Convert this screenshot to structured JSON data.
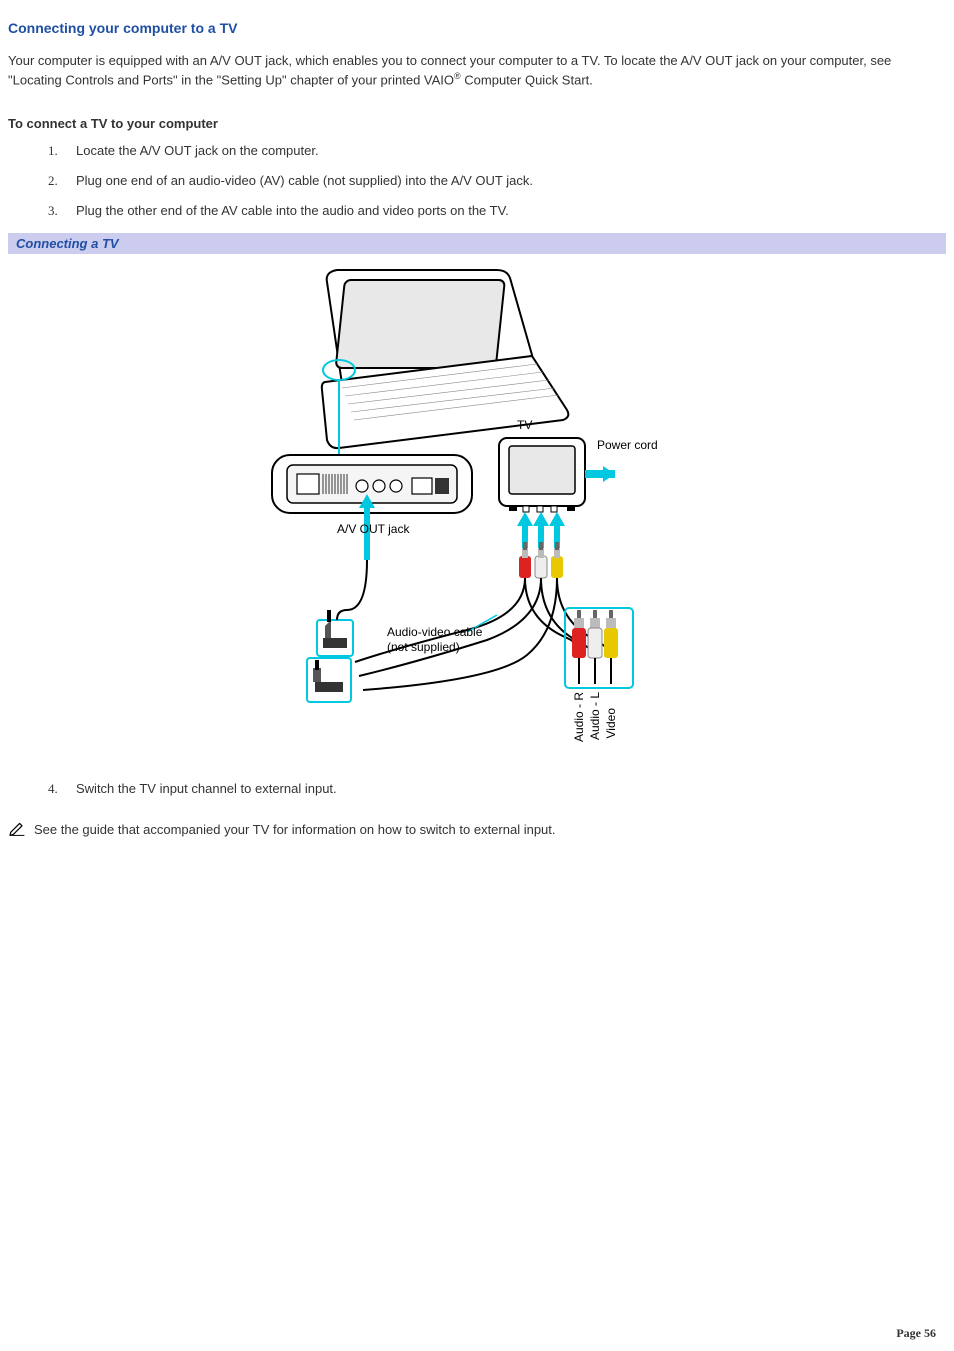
{
  "heading": "Connecting your computer to a TV",
  "intro_pre": "Your computer is equipped with an A/V OUT jack, which enables you to connect your computer to a TV. To locate the A/V OUT jack on your computer, see \"Locating Controls and Ports\" in the \"Setting Up\" chapter of your printed VAIO",
  "intro_reg": "®",
  "intro_post": " Computer Quick Start.",
  "sub_heading": "To connect a TV to your computer",
  "steps_a": [
    {
      "n": "1.",
      "t": "Locate the A/V OUT jack on the computer."
    },
    {
      "n": "2.",
      "t": "Plug one end of an audio-video (AV) cable (not supplied) into the A/V OUT jack."
    },
    {
      "n": "3.",
      "t": "Plug the other end of the AV cable into the audio and video ports on the TV."
    }
  ],
  "figure_caption": "Connecting a TV",
  "figure_labels": {
    "tv": "TV",
    "power_cord": "Power cord",
    "av_out_jack": "A/V OUT jack",
    "av_cable_l1": "Audio-video cable",
    "av_cable_l2": "(not supplied)",
    "audio_r": "Audio - R",
    "audio_l": "Audio - L",
    "video": "Video"
  },
  "steps_b": [
    {
      "n": "4.",
      "t": "Switch the TV input channel to external input."
    }
  ],
  "note_text": "See the guide that accompanied your TV for information on how to switch to external input.",
  "page_number": "Page 56"
}
